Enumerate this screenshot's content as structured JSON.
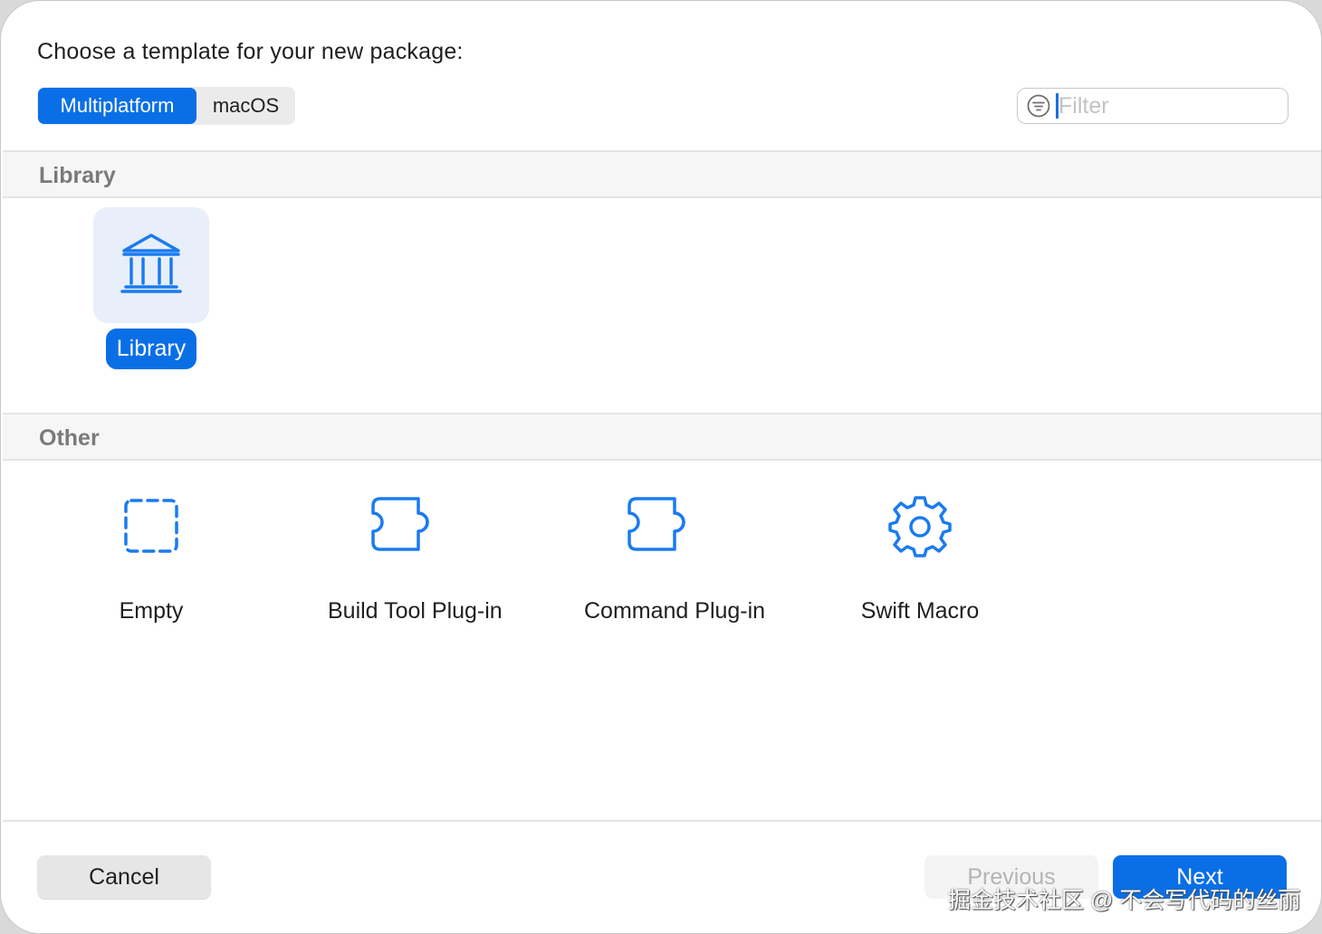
{
  "dialog": {
    "prompt": "Choose a template for your new package:"
  },
  "platform_tabs": [
    {
      "label": "Multiplatform",
      "selected": true
    },
    {
      "label": "macOS",
      "selected": false
    }
  ],
  "filter": {
    "placeholder": "Filter",
    "value": ""
  },
  "sections": [
    {
      "title": "Library",
      "items": [
        {
          "label": "Library",
          "icon": "building-columns-icon",
          "selected": true
        }
      ]
    },
    {
      "title": "Other",
      "items": [
        {
          "label": "Empty",
          "icon": "dashed-square-icon",
          "selected": false
        },
        {
          "label": "Build Tool Plug-in",
          "icon": "puzzle-piece-icon",
          "selected": false
        },
        {
          "label": "Command Plug-in",
          "icon": "puzzle-piece-icon",
          "selected": false
        },
        {
          "label": "Swift Macro",
          "icon": "gear-icon",
          "selected": false
        }
      ]
    }
  ],
  "footer": {
    "cancel_label": "Cancel",
    "previous_label": "Previous",
    "next_label": "Next"
  },
  "watermark": "掘金技术社区 @ 不会写代码的丝丽",
  "colors": {
    "accent": "#0a6fe6",
    "icon": "#1a7bf0",
    "section_title": "#7a7a7a"
  }
}
